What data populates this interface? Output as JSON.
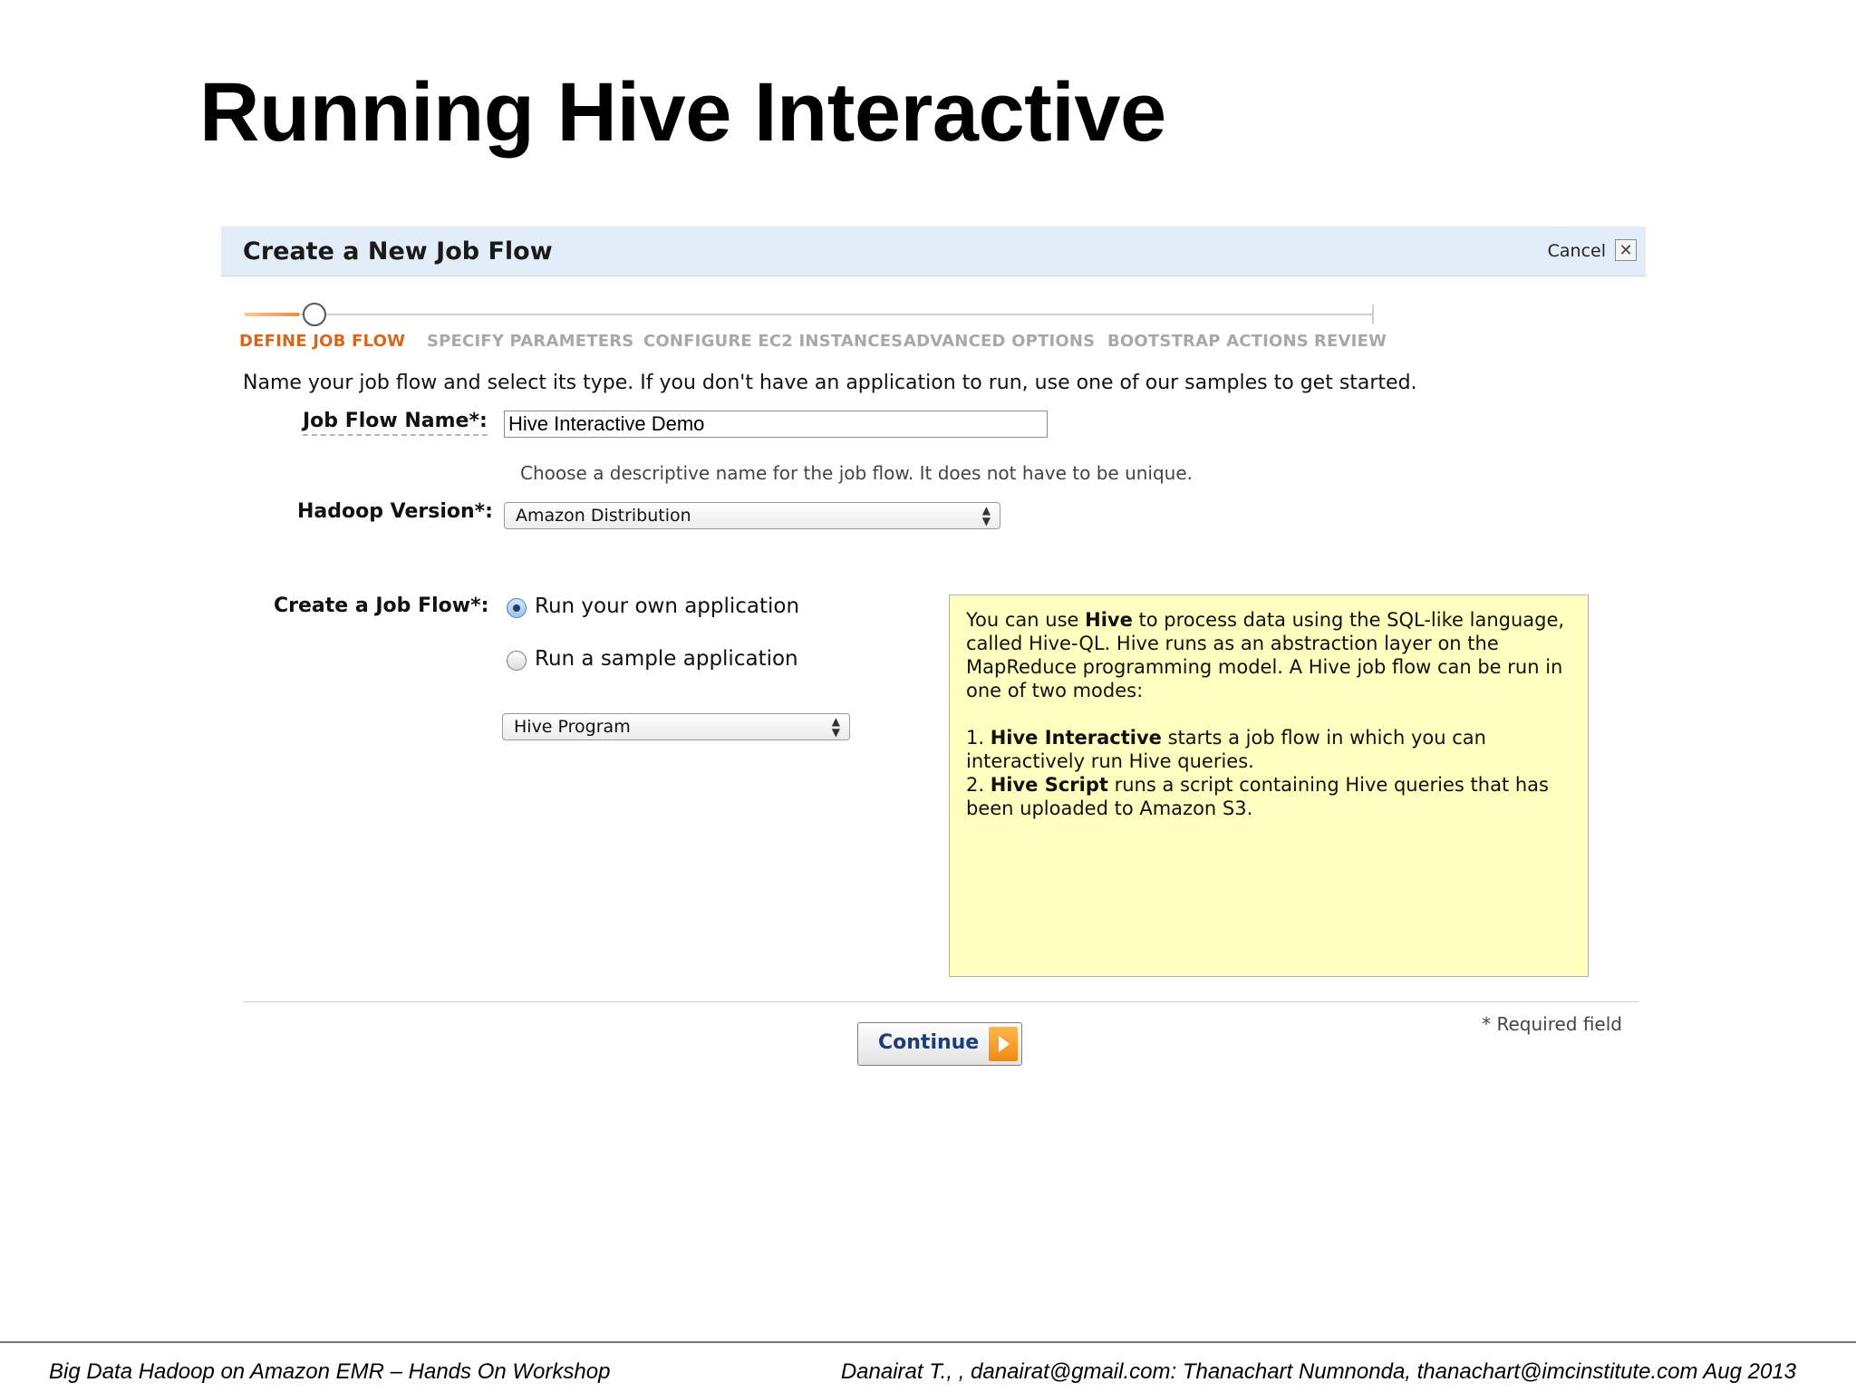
{
  "slide": {
    "title": "Running Hive Interactive",
    "footer_left": "Big Data Hadoop on Amazon EMR – Hands On Workshop",
    "footer_right": "Danairat T., , danairat@gmail.com:  Thanachart Numnonda,  thanachart@imcinstitute.com   Aug 2013"
  },
  "dialog": {
    "title": "Create a New Job Flow",
    "cancel_label": "Cancel",
    "close_glyph": "✕",
    "steps": [
      "DEFINE JOB FLOW",
      "SPECIFY PARAMETERS",
      "CONFIGURE EC2 INSTANCES",
      "ADVANCED OPTIONS",
      "BOOTSTRAP ACTIONS",
      "REVIEW"
    ],
    "active_step": 0,
    "intro": "Name your job flow and select its type. If you don't have an application to run, use one of our samples to get started.",
    "job_flow_name": {
      "label": "Job Flow Name*:",
      "value": "Hive Interactive Demo",
      "hint": "Choose a descriptive name for the job flow. It does not have to be unique."
    },
    "hadoop_version": {
      "label": "Hadoop Version*:",
      "selected": "Amazon Distribution"
    },
    "create_job_flow": {
      "label": "Create a Job Flow*:",
      "option_own": "Run your own application",
      "option_sample": "Run a sample application",
      "selected_option": "own",
      "app_type_selected": "Hive Program"
    },
    "info": {
      "p1_a": "You can use ",
      "p1_b": "Hive",
      "p1_c": " to process data using the SQL-like language, called Hive-QL. Hive runs as an abstraction layer on the MapReduce programming model. A Hive job flow can be run in one of two modes:",
      "i1_num": "1. ",
      "i1_b": "Hive Interactive",
      "i1_c": " starts a job flow in which you can interactively run Hive queries.",
      "i2_num": "2. ",
      "i2_b": "Hive Script",
      "i2_c": " runs a script containing Hive queries that has been uploaded to Amazon S3."
    },
    "continue_label": "Continue",
    "required_note": "* Required field"
  },
  "colors": {
    "header_bg": "#e3edf9",
    "active_step": "#d9661a",
    "inactive_step": "#a8a8a8",
    "info_bg": "#ffffc0",
    "continue_text": "#1b3d78",
    "continue_arrow": "#f08a12"
  },
  "icons": {
    "close": "close-icon",
    "select_arrows": "updown-arrows-icon",
    "continue_arrow": "arrow-right-icon"
  }
}
